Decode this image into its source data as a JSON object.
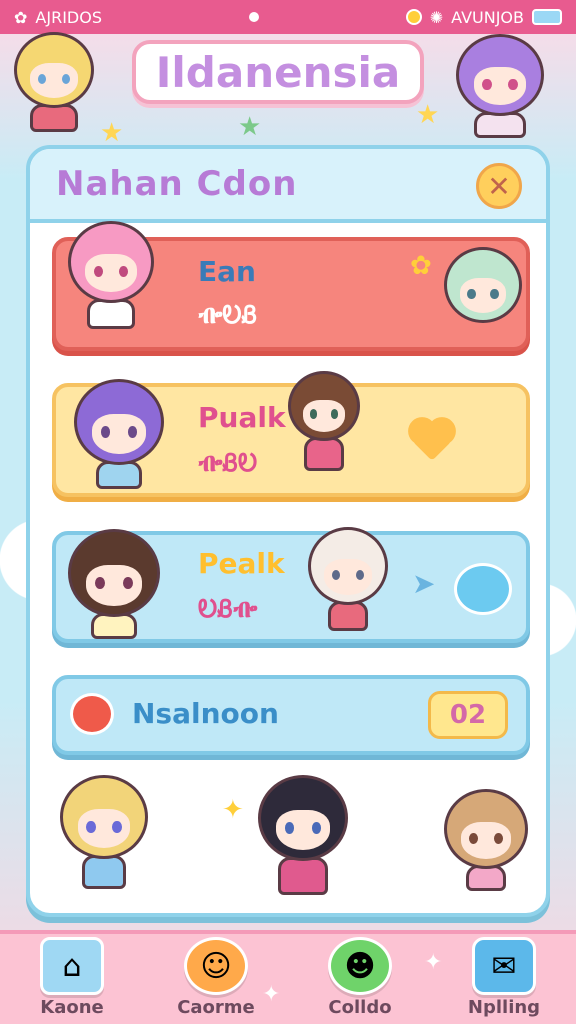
{
  "status_bar": {
    "left_text": "AJRIDOS",
    "right_text": "AVUNJOB"
  },
  "title": "Ildanensia",
  "panel": {
    "title": "Nahan Cdon"
  },
  "cards": [
    {
      "line1": "Ean",
      "line2": "ᎇᎧᏰ"
    },
    {
      "line1": "Pualk",
      "line2": "ᎇᏰᎧ"
    },
    {
      "line1": "Pealk",
      "line2": "ᎧᏰᎇ"
    }
  ],
  "bar_item": {
    "label": "Nsalnoon",
    "badge": "02"
  },
  "nav": [
    {
      "label": "Kaone",
      "icon": "home-icon"
    },
    {
      "label": "Caorme",
      "icon": "smile-face-icon"
    },
    {
      "label": "Colldo",
      "icon": "green-face-icon"
    },
    {
      "label": "Nplling",
      "icon": "message-icon"
    }
  ],
  "colors": {
    "accent": "#e85b8f",
    "panel_border": "#8fd2ea",
    "title_text": "#c48fe0"
  }
}
